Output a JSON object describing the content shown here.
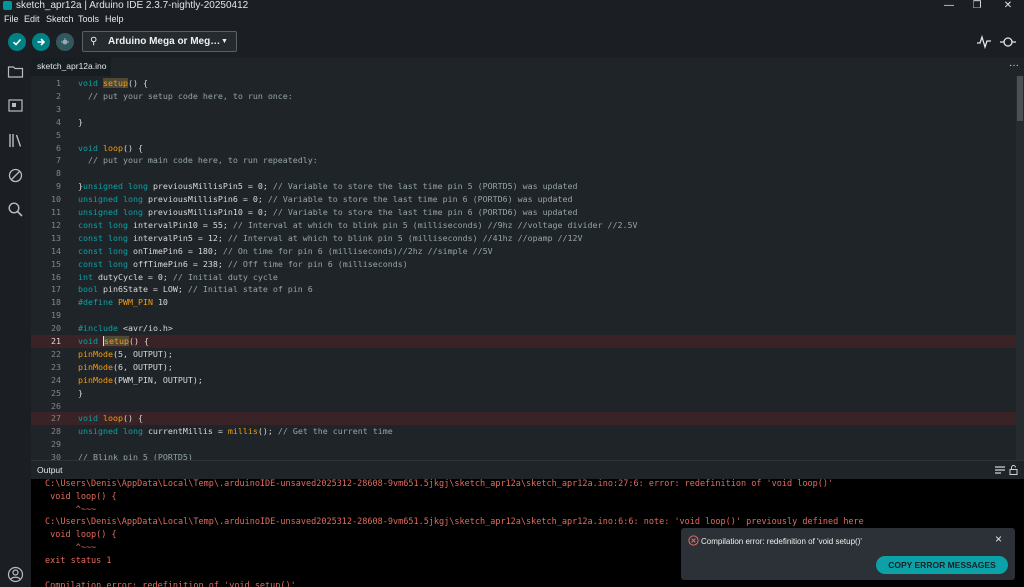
{
  "window": {
    "title": "sketch_apr12a | Arduino IDE 2.3.7-nightly-20250412"
  },
  "menu": [
    "File",
    "Edit",
    "Sketch",
    "Tools",
    "Help"
  ],
  "toolbar": {
    "board": "Arduino Mega or Meg…",
    "chevron": "▼"
  },
  "tab": {
    "label": "sketch_apr12a.ino",
    "more": "···"
  },
  "editor": {
    "lines": [
      {
        "n": "1",
        "parts": [
          [
            "kw",
            "void "
          ],
          [
            "fnh",
            "setup"
          ],
          [
            "",
            "() {"
          ]
        ]
      },
      {
        "n": "2",
        "parts": [
          [
            "cm",
            "  // put your setup code here, to run once:"
          ]
        ]
      },
      {
        "n": "3",
        "parts": []
      },
      {
        "n": "4",
        "parts": [
          [
            "",
            "}"
          ]
        ]
      },
      {
        "n": "5",
        "parts": []
      },
      {
        "n": "6",
        "parts": [
          [
            "kw",
            "void "
          ],
          [
            "fn",
            "loop"
          ],
          [
            "",
            "() {"
          ]
        ]
      },
      {
        "n": "7",
        "parts": [
          [
            "cm",
            "  // put your main code here, to run repeatedly:"
          ]
        ]
      },
      {
        "n": "8",
        "parts": []
      },
      {
        "n": "9",
        "parts": [
          [
            "",
            "}"
          ],
          [
            "kw",
            "unsigned long "
          ],
          [
            "",
            "previousMillisPin5 = 0; "
          ],
          [
            "cm",
            "// Variable to store the last time pin 5 (PORTD5) was updated"
          ]
        ]
      },
      {
        "n": "10",
        "parts": [
          [
            "kw",
            "unsigned long "
          ],
          [
            "",
            "previousMillisPin6 = 0; "
          ],
          [
            "cm",
            "// Variable to store the last time pin 6 (PORTD6) was updated"
          ]
        ]
      },
      {
        "n": "11",
        "parts": [
          [
            "kw",
            "unsigned long "
          ],
          [
            "",
            "previousMillisPin10 = 0; "
          ],
          [
            "cm",
            "// Variable to store the last time pin 6 (PORTD6) was updated"
          ]
        ]
      },
      {
        "n": "12",
        "parts": [
          [
            "kw",
            "const long "
          ],
          [
            "",
            "intervalPin10 = 55; "
          ],
          [
            "cm",
            "// Interval at which to blink pin 5 (milliseconds) //9hz //voltage divider //2.5V"
          ]
        ]
      },
      {
        "n": "13",
        "parts": [
          [
            "kw",
            "const long "
          ],
          [
            "",
            "intervalPin5 = 12; "
          ],
          [
            "cm",
            "// Interval at which to blink pin 5 (milliseconds) //41hz //opamp //12V"
          ]
        ]
      },
      {
        "n": "14",
        "parts": [
          [
            "kw",
            "const long "
          ],
          [
            "",
            "onTimePin6 = 180; "
          ],
          [
            "cm",
            "// On time for pin 6 (milliseconds)//2hz //simple //5V"
          ]
        ]
      },
      {
        "n": "15",
        "parts": [
          [
            "kw",
            "const long "
          ],
          [
            "",
            "offTimePin6 = 238; "
          ],
          [
            "cm",
            "// Off time for pin 6 (milliseconds)"
          ]
        ]
      },
      {
        "n": "16",
        "parts": [
          [
            "kw",
            "int "
          ],
          [
            "",
            "dutyCycle = 0; "
          ],
          [
            "cm",
            "// Initial duty cycle"
          ]
        ]
      },
      {
        "n": "17",
        "parts": [
          [
            "kw",
            "bool "
          ],
          [
            "",
            "pin6State = LOW; "
          ],
          [
            "cm",
            "// Initial state of pin 6"
          ]
        ]
      },
      {
        "n": "18",
        "parts": [
          [
            "kw",
            "#define "
          ],
          [
            "fn",
            "PWM_PIN "
          ],
          [
            "",
            "10"
          ]
        ]
      },
      {
        "n": "19",
        "parts": []
      },
      {
        "n": "20",
        "parts": [
          [
            "kw",
            "#include "
          ],
          [
            "",
            "<avr/io.h>"
          ]
        ]
      },
      {
        "n": "21",
        "err": true,
        "active": true,
        "parts": [
          [
            "kw",
            "void "
          ],
          [
            "caret",
            ""
          ],
          [
            "fnh",
            "setup"
          ],
          [
            "",
            "() {"
          ]
        ]
      },
      {
        "n": "22",
        "parts": [
          [
            "fn",
            "pinMode"
          ],
          [
            "",
            "(5, OUTPUT);"
          ]
        ]
      },
      {
        "n": "23",
        "parts": [
          [
            "fn",
            "pinMode"
          ],
          [
            "",
            "(6, OUTPUT);"
          ]
        ]
      },
      {
        "n": "24",
        "parts": [
          [
            "fn",
            "pinMode"
          ],
          [
            "",
            "(PWM_PIN, OUTPUT);"
          ]
        ]
      },
      {
        "n": "25",
        "parts": [
          [
            "",
            "}"
          ]
        ]
      },
      {
        "n": "26",
        "parts": []
      },
      {
        "n": "27",
        "err": true,
        "parts": [
          [
            "kw",
            "void "
          ],
          [
            "fn",
            "loop"
          ],
          [
            "",
            "() {"
          ]
        ]
      },
      {
        "n": "28",
        "parts": [
          [
            "kw",
            "unsigned long "
          ],
          [
            "",
            "currentMillis = "
          ],
          [
            "fn",
            "millis"
          ],
          [
            "",
            "(); "
          ],
          [
            "cm",
            "// Get the current time"
          ]
        ]
      },
      {
        "n": "29",
        "parts": []
      },
      {
        "n": "30",
        "parts": [
          [
            "cm",
            "// Blink pin 5 (PORTD5)"
          ]
        ]
      }
    ]
  },
  "output": {
    "header": "Output",
    "lines": [
      "C:\\Users\\Denis\\AppData\\Local\\Temp\\.arduinoIDE-unsaved2025312-28608-9vm651.5jkgj\\sketch_apr12a\\sketch_apr12a.ino:27:6: error: redefinition of 'void loop()'",
      " void loop() {",
      "      ^~~~",
      "C:\\Users\\Denis\\AppData\\Local\\Temp\\.arduinoIDE-unsaved2025312-28608-9vm651.5jkgj\\sketch_apr12a\\sketch_apr12a.ino:6:6: note: 'void loop()' previously defined here",
      " void loop() {",
      "      ^~~~",
      "exit status 1",
      "",
      "Compilation error: redefinition of 'void setup()'"
    ]
  },
  "toast": {
    "message": "Compilation error: redefinition of 'void setup()'",
    "button": "COPY ERROR MESSAGES",
    "close": "×"
  },
  "colors": {
    "accent": "#008184",
    "error": "#e46b5e",
    "keyword": "#0ca1a6",
    "function": "#f39c12"
  }
}
